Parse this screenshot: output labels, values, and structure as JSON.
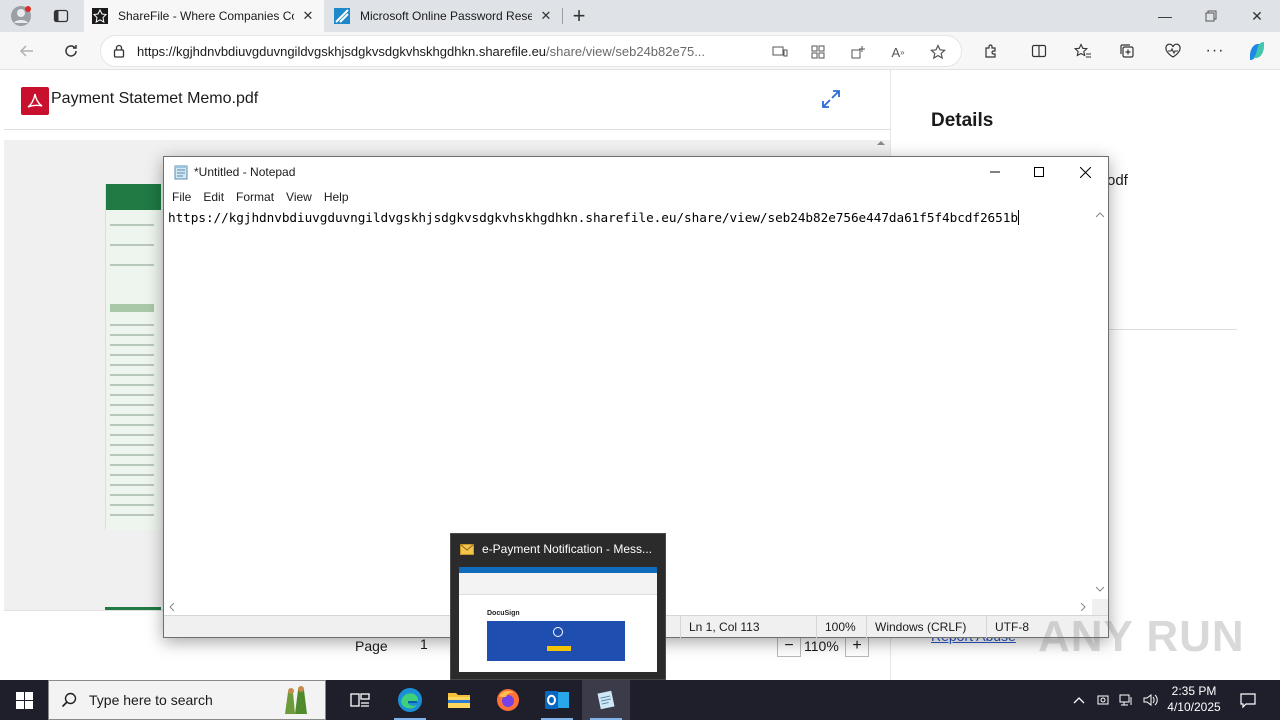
{
  "browser": {
    "tabs": [
      {
        "title": "ShareFile - Where Companies Co",
        "active": true
      },
      {
        "title": "Microsoft Online Password Reset",
        "active": false
      }
    ],
    "address": {
      "host": "https://kgjhdnvbdiuvgduvngildvgskhjsdgkvsdgkvhskhgdhkn.sharefile.eu",
      "path": "/share/view/seb24b82e75..."
    }
  },
  "viewer": {
    "file_name": "Payment Statemet Memo.pdf",
    "page_label": "Page",
    "page_value": "1",
    "zoom_value": "110%",
    "zoom_minus": "−",
    "zoom_plus": "+"
  },
  "details": {
    "title": "Details",
    "partial_text": "odf",
    "report_link": "Report Abuse"
  },
  "notepad": {
    "title": "*Untitled - Notepad",
    "menu": [
      "File",
      "Edit",
      "Format",
      "View",
      "Help"
    ],
    "content": "https://kgjhdnvbdiuvgduvngildvgskhjsdgkvsdgkvhskhgdhkn.sharefile.eu/share/view/seb24b82e756e447da61f5f4bcdf2651b",
    "status": {
      "position": "Ln 1, Col 113",
      "zoom": "100%",
      "line_ending": "Windows (CRLF)",
      "encoding": "UTF-8"
    }
  },
  "thumbnail_popup": {
    "title": "e-Payment Notification - Mess...",
    "preview_brand": "DocuSign"
  },
  "watermark": "ANY RUN",
  "taskbar": {
    "search_placeholder": "Type here to search",
    "time": "2:35 PM",
    "date": "4/10/2025"
  }
}
